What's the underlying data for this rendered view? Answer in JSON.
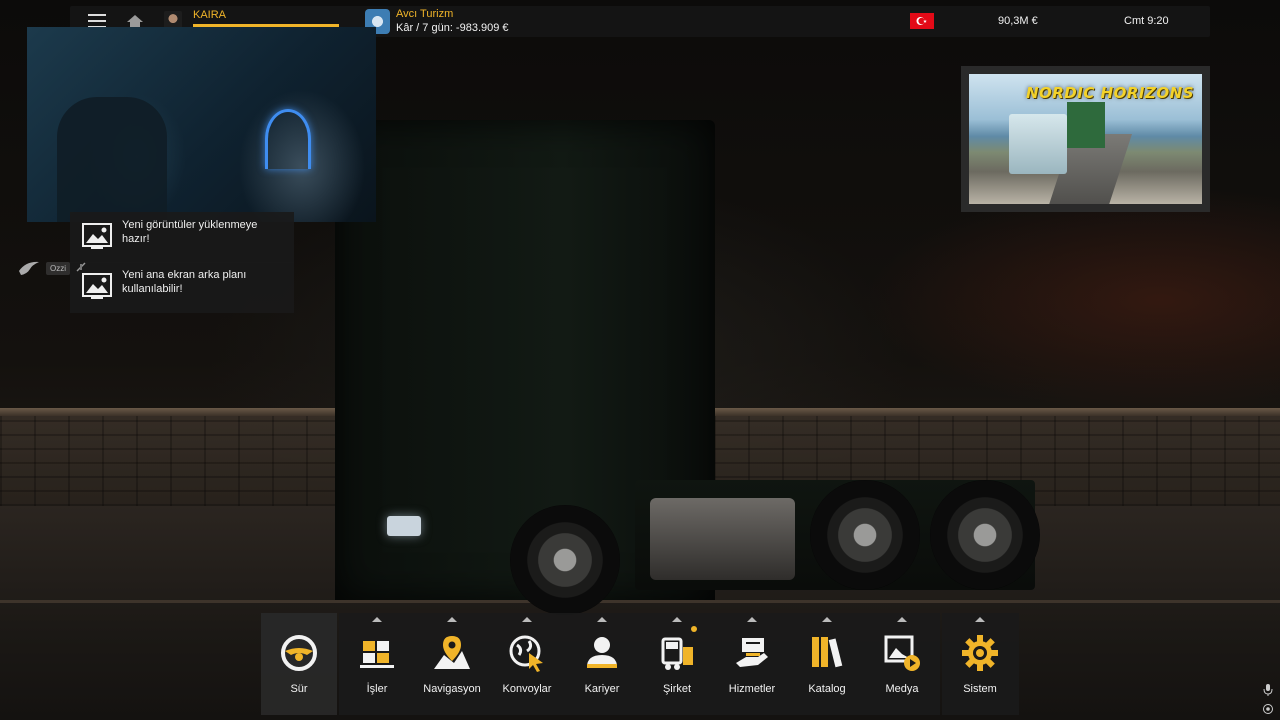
{
  "topbar": {
    "player_name": "KAIRA",
    "company_name": "Avcı Turizm",
    "company_profit": "Kâr / 7 gün: -983.909 €",
    "money": "90,3M  €",
    "clock": "Cmt 9:20"
  },
  "notifications": [
    {
      "text": "Yeni görüntüler yüklenmeye hazır!",
      "icon": "image-icon"
    },
    {
      "text": "Yeni ana ekran arka planı kullanılabilir!",
      "icon": "image-icon"
    }
  ],
  "chat": {
    "name": "Ozzi"
  },
  "banner": {
    "title": "NORDIC HORIZONS"
  },
  "dock": {
    "items": [
      {
        "label": "Sür",
        "icon": "steering-wheel-icon"
      },
      {
        "label": "İşler",
        "icon": "cargo-icon"
      },
      {
        "label": "Navigasyon",
        "icon": "map-pin-icon"
      },
      {
        "label": "Konvoylar",
        "icon": "globe-cursor-icon"
      },
      {
        "label": "Kariyer",
        "icon": "person-icon"
      },
      {
        "label": "Şirket",
        "icon": "truck-company-icon"
      },
      {
        "label": "Hizmetler",
        "icon": "service-hand-icon"
      },
      {
        "label": "Katalog",
        "icon": "books-icon"
      },
      {
        "label": "Medya",
        "icon": "media-icon"
      },
      {
        "label": "Sistem",
        "icon": "gear-icon"
      }
    ]
  },
  "colors": {
    "accent": "#f0b429",
    "panel": "#1a1a1a",
    "flag_red": "#e30a17"
  }
}
